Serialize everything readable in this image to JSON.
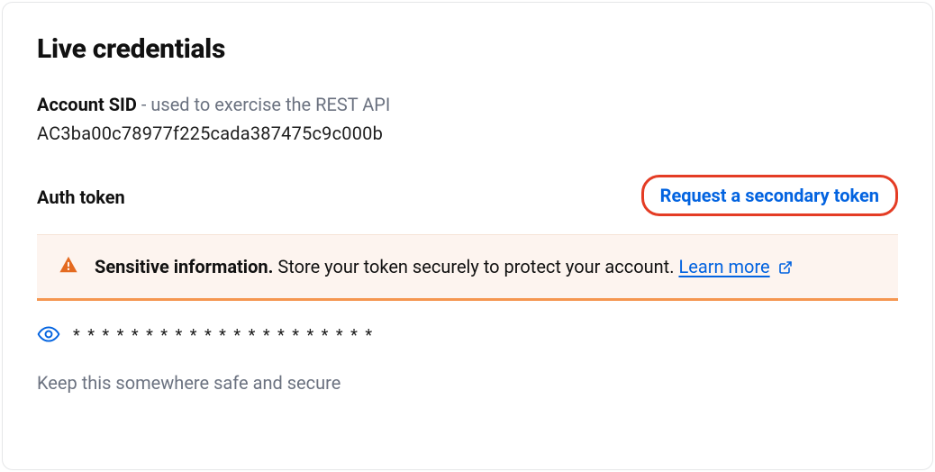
{
  "credentials": {
    "title": "Live credentials",
    "account_sid": {
      "label": "Account SID",
      "separator": " - ",
      "description": "used to exercise the REST API",
      "value": "AC3ba00c78977f225cada387475c9c000b"
    },
    "auth_token": {
      "label": "Auth token",
      "request_link": "Request a secondary token",
      "alert": {
        "strong": "Sensitive information.",
        "body": " Store your token securely to protect your account. ",
        "learn_more": "Learn more"
      },
      "masked_value": "* * * * * * * * * * * * * * * * * * * * *",
      "footer": "Keep this somewhere safe and secure"
    }
  }
}
